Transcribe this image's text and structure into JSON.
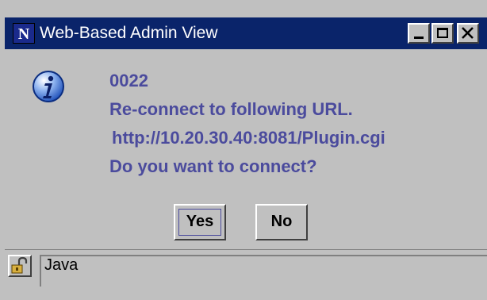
{
  "window": {
    "title": "Web-Based Admin View",
    "logo_letter": "N"
  },
  "dialog": {
    "icon": "info-icon",
    "message_lines": [
      "0022",
      "Re-connect to following URL.",
      "http://10.20.30.40:8081/Plugin.cgi",
      "Do you want to connect?"
    ],
    "buttons": {
      "yes_label": "Yes",
      "no_label": "No"
    }
  },
  "statusbar": {
    "icon": "unlocked-padlock-icon",
    "text": "Java"
  },
  "colors": {
    "titlebar": "#0a246a",
    "message_text": "#4b4b9d",
    "face": "#c0c0c0"
  }
}
